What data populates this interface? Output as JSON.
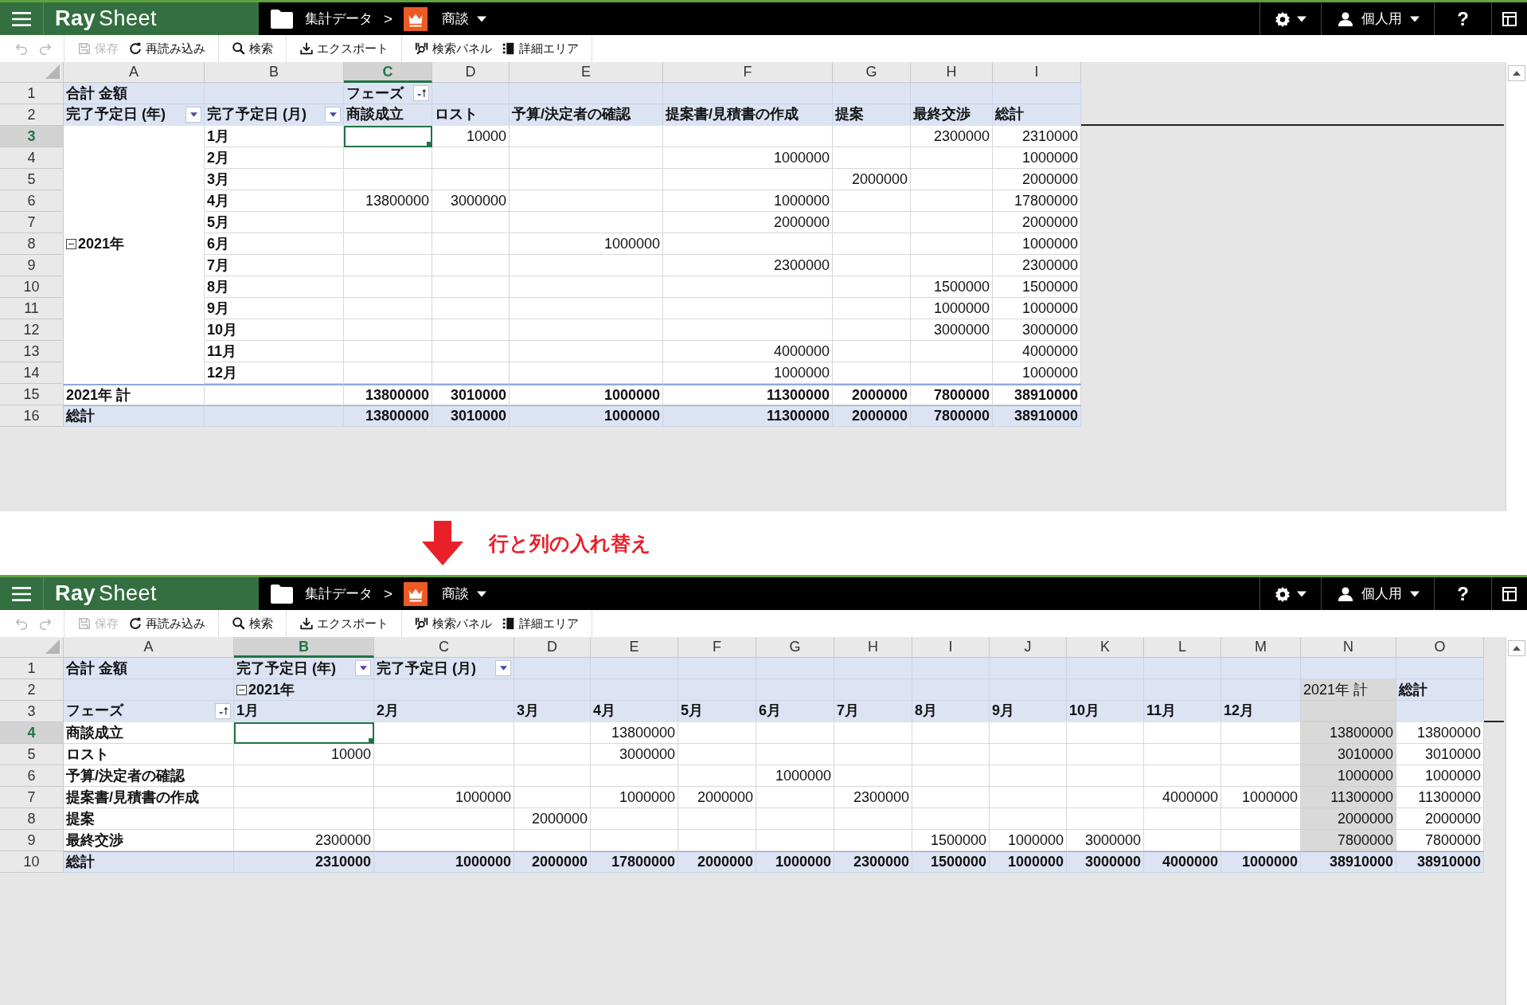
{
  "panels": [
    {
      "app_bar": {
        "logo_bold": "Ray",
        "logo_rest": "Sheet",
        "folder": "集計データ",
        "separator": ">",
        "table": "商談",
        "user": "個人用",
        "help": "?"
      },
      "toolbar": [
        {
          "items": [
            {
              "disabled": true
            },
            {
              "disabled": true
            }
          ]
        },
        {
          "items": [
            {
              "label": "保存",
              "disabled": true
            },
            {
              "label": "再読み込み",
              "disabled": false
            }
          ]
        },
        {
          "items": [
            {
              "label": "検索",
              "disabled": false
            }
          ]
        },
        {
          "items": [
            {
              "label": "エクスポート",
              "disabled": false
            }
          ]
        },
        {
          "items": [
            {
              "label": "検索パネル",
              "disabled": false
            },
            {
              "label": "詳細エリア",
              "disabled": false
            }
          ]
        }
      ],
      "grid": {
        "columns": [
          {
            "label": "A",
            "selected": false
          },
          {
            "label": "B",
            "selected": false
          },
          {
            "label": "C",
            "selected": true
          },
          {
            "label": "D",
            "selected": false
          },
          {
            "label": "E",
            "selected": false
          },
          {
            "label": "F",
            "selected": false
          },
          {
            "label": "G",
            "selected": false
          },
          {
            "label": "H",
            "selected": false
          },
          {
            "label": "I",
            "selected": false
          }
        ],
        "rows": [
          {
            "number": "1",
            "kind": "header",
            "selected": false,
            "cells": [
              {
                "kind": "label",
                "text": "合計 金額"
              },
              null,
              {
                "kind": "sort",
                "text": "フェーズ"
              },
              null,
              null,
              null,
              null,
              null,
              null
            ]
          },
          {
            "number": "2",
            "kind": "header",
            "selected": false,
            "freeze_line": true,
            "cells": [
              {
                "kind": "filter",
                "text": "完了予定日 (年)"
              },
              {
                "kind": "filter",
                "text": "完了予定日 (月)"
              },
              {
                "kind": "label",
                "text": "商談成立"
              },
              {
                "kind": "label",
                "text": "ロスト"
              },
              {
                "kind": "label",
                "text": "予算/決定者の確認"
              },
              {
                "kind": "label",
                "text": "提案書/見積書の作成"
              },
              {
                "kind": "label",
                "text": "提案"
              },
              {
                "kind": "label",
                "text": "最終交渉"
              },
              {
                "kind": "label",
                "text": "総計"
              }
            ]
          },
          {
            "number": "3",
            "kind": "body",
            "selected": true,
            "cells": [
              {
                "kind": "merged"
              },
              {
                "kind": "label",
                "text": "1月"
              },
              null,
              "10000",
              null,
              null,
              null,
              "2300000",
              "2310000"
            ]
          },
          {
            "number": "4",
            "kind": "body",
            "selected": false,
            "cells": [
              {
                "kind": "merged"
              },
              {
                "kind": "label",
                "text": "2月"
              },
              null,
              null,
              null,
              "1000000",
              null,
              null,
              "1000000"
            ]
          },
          {
            "number": "5",
            "kind": "body",
            "selected": false,
            "cells": [
              {
                "kind": "merged"
              },
              {
                "kind": "label",
                "text": "3月"
              },
              null,
              null,
              null,
              null,
              "2000000",
              null,
              "2000000"
            ]
          },
          {
            "number": "6",
            "kind": "body",
            "selected": false,
            "cells": [
              {
                "kind": "merged"
              },
              {
                "kind": "label",
                "text": "4月"
              },
              "13800000",
              "3000000",
              null,
              "1000000",
              null,
              null,
              "17800000"
            ]
          },
          {
            "number": "7",
            "kind": "body",
            "selected": false,
            "cells": [
              {
                "kind": "merged"
              },
              {
                "kind": "label",
                "text": "5月"
              },
              null,
              null,
              null,
              "2000000",
              null,
              null,
              "2000000"
            ]
          },
          {
            "number": "8",
            "kind": "body",
            "selected": false,
            "cells": [
              {
                "kind": "year",
                "text": "2021年",
                "expanded": true
              },
              {
                "kind": "label",
                "text": "6月"
              },
              null,
              null,
              "1000000",
              null,
              null,
              null,
              "1000000"
            ]
          },
          {
            "number": "9",
            "kind": "body",
            "selected": false,
            "cells": [
              {
                "kind": "merged"
              },
              {
                "kind": "label",
                "text": "7月"
              },
              null,
              null,
              null,
              "2300000",
              null,
              null,
              "2300000"
            ]
          },
          {
            "number": "10",
            "kind": "body",
            "selected": false,
            "cells": [
              {
                "kind": "merged"
              },
              {
                "kind": "label",
                "text": "8月"
              },
              null,
              null,
              null,
              null,
              null,
              "1500000",
              "1500000"
            ]
          },
          {
            "number": "11",
            "kind": "body",
            "selected": false,
            "cells": [
              {
                "kind": "merged"
              },
              {
                "kind": "label",
                "text": "9月"
              },
              null,
              null,
              null,
              null,
              null,
              "1000000",
              "1000000"
            ]
          },
          {
            "number": "12",
            "kind": "body",
            "selected": false,
            "cells": [
              {
                "kind": "merged"
              },
              {
                "kind": "label",
                "text": "10月"
              },
              null,
              null,
              null,
              null,
              null,
              "3000000",
              "3000000"
            ]
          },
          {
            "number": "13",
            "kind": "body",
            "selected": false,
            "cells": [
              {
                "kind": "merged"
              },
              {
                "kind": "label",
                "text": "11月"
              },
              null,
              null,
              null,
              "4000000",
              null,
              null,
              "4000000"
            ]
          },
          {
            "number": "14",
            "kind": "body",
            "selected": false,
            "cells": [
              {
                "kind": "merged"
              },
              {
                "kind": "label",
                "text": "12月"
              },
              null,
              null,
              null,
              "1000000",
              null,
              null,
              "1000000"
            ]
          },
          {
            "number": "15",
            "kind": "subtotal",
            "selected": false,
            "cells": [
              {
                "kind": "label",
                "text": "2021年 計"
              },
              null,
              "13800000",
              "3010000",
              "1000000",
              "11300000",
              "2000000",
              "7800000",
              "38910000"
            ]
          },
          {
            "number": "16",
            "kind": "grand",
            "selected": false,
            "cells": [
              {
                "kind": "label",
                "text": "総計"
              },
              null,
              "13800000",
              "3010000",
              "1000000",
              "11300000",
              "2000000",
              "7800000",
              "38910000"
            ]
          }
        ]
      }
    },
    {
      "app_bar": {
        "logo_bold": "Ray",
        "logo_rest": "Sheet",
        "folder": "集計データ",
        "separator": ">",
        "table": "商談",
        "user": "個人用",
        "help": "?"
      },
      "toolbar": [
        {
          "items": [
            {
              "disabled": true
            },
            {
              "disabled": true
            }
          ]
        },
        {
          "items": [
            {
              "label": "保存",
              "disabled": true
            },
            {
              "label": "再読み込み",
              "disabled": false
            }
          ]
        },
        {
          "items": [
            {
              "label": "検索",
              "disabled": false
            }
          ]
        },
        {
          "items": [
            {
              "label": "エクスポート",
              "disabled": false
            }
          ]
        },
        {
          "items": [
            {
              "label": "検索パネル",
              "disabled": false
            },
            {
              "label": "詳細エリア",
              "disabled": false
            }
          ]
        }
      ],
      "grid": {
        "columns": [
          {
            "label": "A",
            "selected": false
          },
          {
            "label": "B",
            "selected": true
          },
          {
            "label": "C",
            "selected": false
          },
          {
            "label": "D",
            "selected": false
          },
          {
            "label": "E",
            "selected": false
          },
          {
            "label": "F",
            "selected": false
          },
          {
            "label": "G",
            "selected": false
          },
          {
            "label": "H",
            "selected": false
          },
          {
            "label": "I",
            "selected": false
          },
          {
            "label": "J",
            "selected": false
          },
          {
            "label": "K",
            "selected": false
          },
          {
            "label": "L",
            "selected": false
          },
          {
            "label": "M",
            "selected": false
          },
          {
            "label": "N",
            "selected": false
          },
          {
            "label": "O",
            "selected": false
          }
        ],
        "rows": [
          {
            "number": "1",
            "kind": "header",
            "selected": false,
            "cells": [
              {
                "kind": "label",
                "text": "合計 金額"
              },
              {
                "kind": "filter",
                "text": "完了予定日 (年)"
              },
              {
                "kind": "filter",
                "text": "完了予定日 (月)"
              },
              null,
              null,
              null,
              null,
              null,
              null,
              null,
              null,
              null,
              null,
              null,
              null
            ]
          },
          {
            "number": "2",
            "kind": "header",
            "selected": false,
            "cells": [
              null,
              {
                "kind": "year",
                "text": "2021年",
                "expanded": true
              },
              null,
              null,
              null,
              null,
              null,
              null,
              null,
              null,
              null,
              null,
              null,
              {
                "kind": "plain",
                "text": "2021年 計",
                "shaded": true
              },
              {
                "kind": "label",
                "text": "総計"
              }
            ]
          },
          {
            "number": "3",
            "kind": "header",
            "selected": false,
            "freeze_line": true,
            "cells": [
              {
                "kind": "sort",
                "text": "フェーズ"
              },
              {
                "kind": "label",
                "text": "1月"
              },
              {
                "kind": "label",
                "text": "2月"
              },
              {
                "kind": "label",
                "text": "3月"
              },
              {
                "kind": "label",
                "text": "4月"
              },
              {
                "kind": "label",
                "text": "5月"
              },
              {
                "kind": "label",
                "text": "6月"
              },
              {
                "kind": "label",
                "text": "7月"
              },
              {
                "kind": "label",
                "text": "8月"
              },
              {
                "kind": "label",
                "text": "9月"
              },
              {
                "kind": "label",
                "text": "10月"
              },
              {
                "kind": "label",
                "text": "11月"
              },
              {
                "kind": "label",
                "text": "12月"
              },
              {
                "kind": "blank",
                "shaded": true
              },
              null
            ]
          },
          {
            "number": "4",
            "kind": "body",
            "selected": true,
            "cells": [
              {
                "kind": "label",
                "text": "商談成立"
              },
              null,
              null,
              null,
              "13800000",
              null,
              null,
              null,
              null,
              null,
              null,
              null,
              null,
              {
                "kind": "value",
                "text": "13800000",
                "shaded": true
              },
              "13800000"
            ]
          },
          {
            "number": "5",
            "kind": "body",
            "selected": false,
            "cells": [
              {
                "kind": "label",
                "text": "ロスト"
              },
              "10000",
              null,
              null,
              "3000000",
              null,
              null,
              null,
              null,
              null,
              null,
              null,
              null,
              {
                "kind": "value",
                "text": "3010000",
                "shaded": true
              },
              "3010000"
            ]
          },
          {
            "number": "6",
            "kind": "body",
            "selected": false,
            "cells": [
              {
                "kind": "label",
                "text": "予算/決定者の確認"
              },
              null,
              null,
              null,
              null,
              null,
              "1000000",
              null,
              null,
              null,
              null,
              null,
              null,
              {
                "kind": "value",
                "text": "1000000",
                "shaded": true
              },
              "1000000"
            ]
          },
          {
            "number": "7",
            "kind": "body",
            "selected": false,
            "cells": [
              {
                "kind": "label",
                "text": "提案書/見積書の作成"
              },
              null,
              "1000000",
              null,
              "1000000",
              "2000000",
              null,
              "2300000",
              null,
              null,
              null,
              "4000000",
              "1000000",
              {
                "kind": "value",
                "text": "11300000",
                "shaded": true
              },
              "11300000"
            ]
          },
          {
            "number": "8",
            "kind": "body",
            "selected": false,
            "cells": [
              {
                "kind": "label",
                "text": "提案"
              },
              null,
              null,
              "2000000",
              null,
              null,
              null,
              null,
              null,
              null,
              null,
              null,
              null,
              {
                "kind": "value",
                "text": "2000000",
                "shaded": true
              },
              "2000000"
            ]
          },
          {
            "number": "9",
            "kind": "body",
            "selected": false,
            "cells": [
              {
                "kind": "label",
                "text": "最終交渉"
              },
              "2300000",
              null,
              null,
              null,
              null,
              null,
              null,
              "1500000",
              "1000000",
              "3000000",
              null,
              null,
              {
                "kind": "value",
                "text": "7800000",
                "shaded": true
              },
              "7800000"
            ]
          },
          {
            "number": "10",
            "kind": "grand",
            "selected": false,
            "cells": [
              {
                "kind": "label",
                "text": "総計"
              },
              "2310000",
              "1000000",
              "2000000",
              "17800000",
              "2000000",
              "1000000",
              "2300000",
              "1500000",
              "1000000",
              "3000000",
              "4000000",
              "1000000",
              "38910000",
              "38910000"
            ]
          }
        ]
      }
    }
  ],
  "caption": "行と列の入れ替え"
}
